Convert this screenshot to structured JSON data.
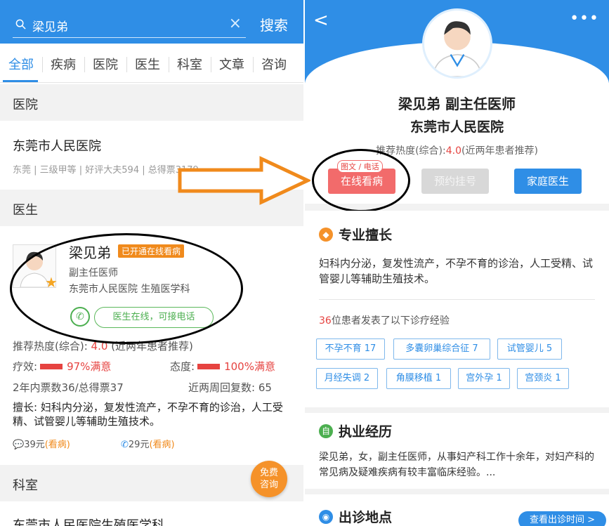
{
  "left": {
    "search": {
      "value": "梁见弟",
      "button": "搜索",
      "clear": "×"
    },
    "tabs": [
      "全部",
      "疾病",
      "医院",
      "医生",
      "科室",
      "文章",
      "咨询"
    ],
    "sections": {
      "hospital": "医院",
      "doctor": "医生",
      "dept": "科室"
    },
    "hospital": {
      "name": "东莞市人民医院",
      "meta": "东莞 | 三级甲等 | 好评大夫594 | 总得票3179"
    },
    "doctor": {
      "name": "梁见弟",
      "badge": "已开通在线看病",
      "title": "副主任医师",
      "hospital": "东莞市人民医院 生殖医学科",
      "phone_status": "医生在线，可接电话",
      "recommend_label": "推荐热度(综合):",
      "recommend_value": "4.0",
      "recommend_note": "(近两年患者推荐)",
      "effect_label": "疗效:",
      "effect_value": "97%满意",
      "attitude_label": "态度:",
      "attitude_value": "100%满意",
      "votes": "2年内票数36/总得票37",
      "revisit": "近两周回复数: 65",
      "expertise": "擅长: 妇科内分泌，复发性流产，不孕不育的诊治，人工受精、试管婴儿等辅助生殖技术。",
      "price_text": "39元",
      "price_text_action": "(看病)",
      "price_phone": "29元",
      "price_phone_action": "(看病)"
    },
    "consult_btn": {
      "line1": "免费",
      "line2": "咨询"
    },
    "dept_name": "东莞市人民医院生殖医学科"
  },
  "right": {
    "header": {
      "back": "<",
      "more": "•••"
    },
    "doctor": {
      "name_title": "梁见弟  副主任医师",
      "hospital": "东莞市人民医院",
      "recommend_label": "推荐热度(综合):",
      "recommend_value": "4.0",
      "recommend_note": "(近两年患者推荐)"
    },
    "buttons": {
      "online_tag": "图文 / 电话",
      "online": "在线看病",
      "appointment": "预约挂号",
      "family": "家庭医生"
    },
    "expertise": {
      "title": "专业擅长",
      "text": "妇科内分泌，复发性流产，不孕不育的诊治，人工受精、试管婴儿等辅助生殖技术。",
      "patients_count": "36",
      "patients_text": "位患者发表了以下诊疗经验",
      "tags": [
        "不孕不育 17",
        "多囊卵巢综合征 7",
        "试管婴儿 5",
        "月经失调 2",
        "角膜移植 1",
        "宫外孕 1",
        "宫颈炎 1"
      ]
    },
    "experience": {
      "title": "执业经历",
      "text": "梁见弟，女，副主任医师，从事妇产科工作十余年，对妇产科的常见病及疑难疾病有较丰富临床经验。..."
    },
    "location": {
      "title": "出诊地点",
      "button": "查看出诊时间 >"
    }
  },
  "colors": {
    "primary": "#2f8ee6",
    "red": "#e64340",
    "orange": "#f08a1c",
    "green": "#4caf50"
  }
}
